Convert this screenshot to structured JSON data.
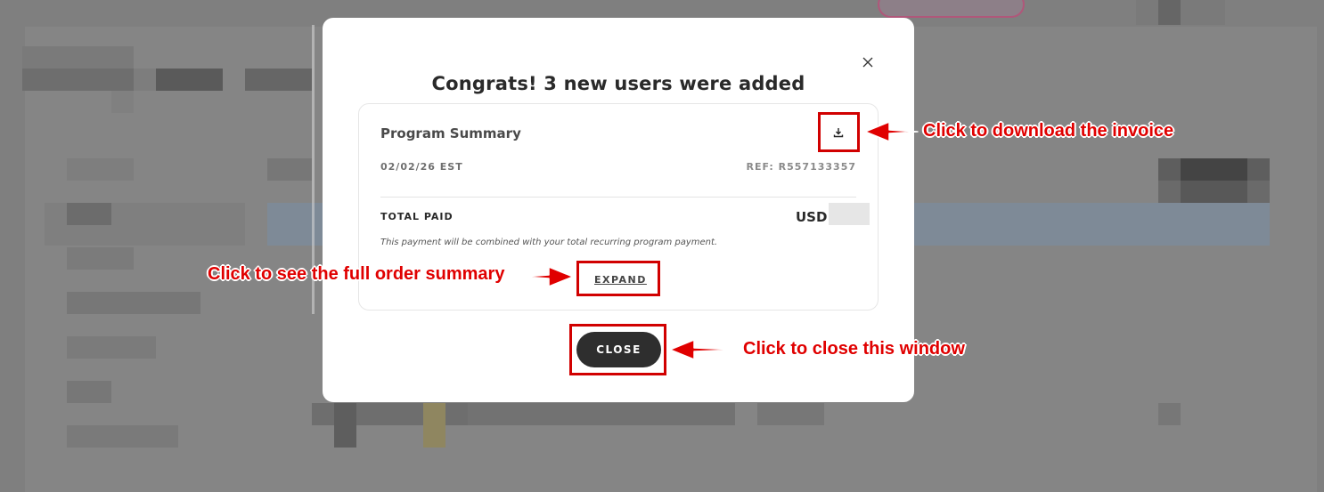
{
  "modal": {
    "title": "Congrats! 3 new users were added",
    "close_icon": "close-icon",
    "summary": {
      "title": "Program Summary",
      "download_icon": "download-icon",
      "date": "02/02/26 EST",
      "ref": "REF: R557133357",
      "total_label": "TOTAL PAID",
      "currency": "USD",
      "note": "This payment will be combined with your total recurring program payment.",
      "expand_label": "EXPAND"
    },
    "close_button_label": "CLOSE"
  },
  "annotations": {
    "download": "Click to download the invoice",
    "expand": "Click to see the full order summary",
    "close": "Click to close this window"
  },
  "colors": {
    "annotation": "#e00000",
    "overlay": "#808080",
    "button_dark": "#2e2e2e"
  }
}
